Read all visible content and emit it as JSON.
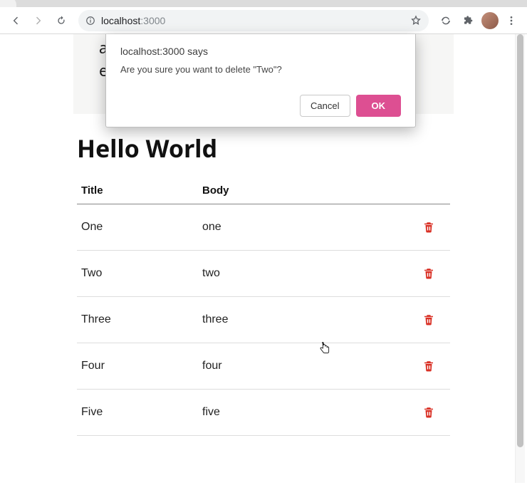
{
  "browser": {
    "url_host": "localhost",
    "url_port": ":3000"
  },
  "dialog": {
    "origin": "localhost:3000 says",
    "message": "Are you sure you want to delete \"Two\"?",
    "cancel_label": "Cancel",
    "ok_label": "OK"
  },
  "intro": {
    "text": "a table row with a delete button and fade effect."
  },
  "page": {
    "heading": "Hello World",
    "columns": {
      "title": "Title",
      "body": "Body"
    },
    "rows": [
      {
        "title": "One",
        "body": "one"
      },
      {
        "title": "Two",
        "body": "two"
      },
      {
        "title": "Three",
        "body": "three"
      },
      {
        "title": "Four",
        "body": "four"
      },
      {
        "title": "Five",
        "body": "five"
      }
    ]
  },
  "colors": {
    "accent": "#dd4f92",
    "danger": "#d93025"
  }
}
